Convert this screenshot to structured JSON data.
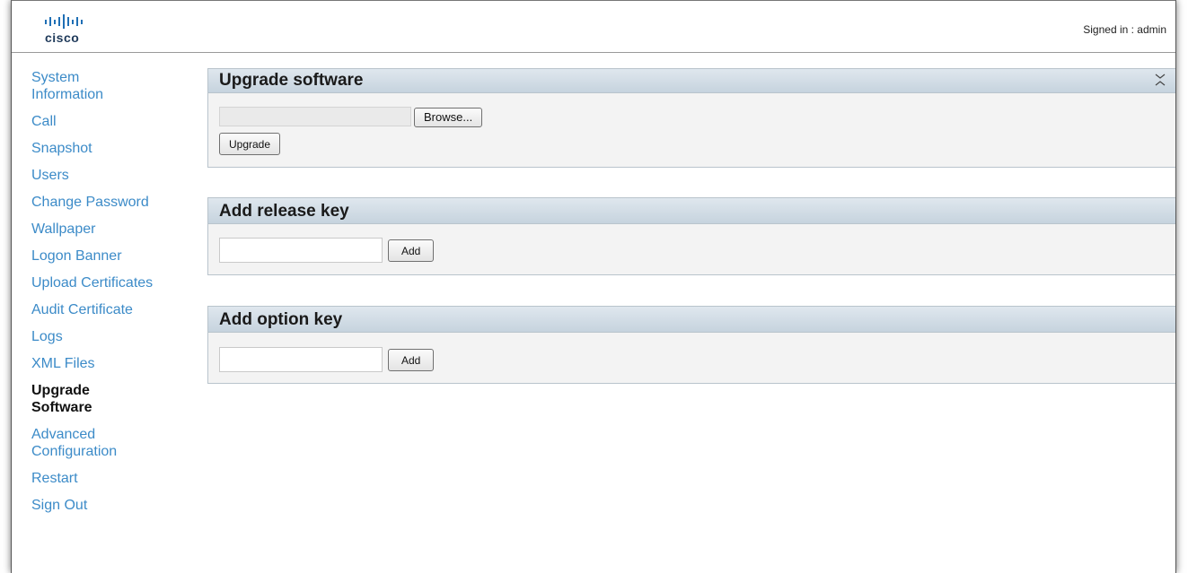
{
  "header": {
    "logo_text": "cisco",
    "signed_in": "Signed in : admin"
  },
  "sidebar": {
    "items": [
      {
        "label": "System\nInformation",
        "active": false
      },
      {
        "label": "Call",
        "active": false
      },
      {
        "label": "Snapshot",
        "active": false
      },
      {
        "label": "Users",
        "active": false
      },
      {
        "label": "Change Password",
        "active": false
      },
      {
        "label": "Wallpaper",
        "active": false
      },
      {
        "label": "Logon Banner",
        "active": false
      },
      {
        "label": "Upload Certificates",
        "active": false
      },
      {
        "label": "Audit Certificate",
        "active": false
      },
      {
        "label": "Logs",
        "active": false
      },
      {
        "label": "XML Files",
        "active": false
      },
      {
        "label": "Upgrade\nSoftware",
        "active": true
      },
      {
        "label": "Advanced\nConfiguration",
        "active": false
      },
      {
        "label": "Restart",
        "active": false
      },
      {
        "label": "Sign Out",
        "active": false
      }
    ]
  },
  "upgrade": {
    "title": "Upgrade software",
    "browse_label": "Browse...",
    "upgrade_label": "Upgrade"
  },
  "release_key": {
    "title": "Add release key",
    "add_label": "Add"
  },
  "option_key": {
    "title": "Add option key",
    "add_label": "Add"
  },
  "colors": {
    "nav_link": "#3c8bc8",
    "panel_header": "#c6d3de",
    "logo_blue": "#1f6fb5"
  }
}
